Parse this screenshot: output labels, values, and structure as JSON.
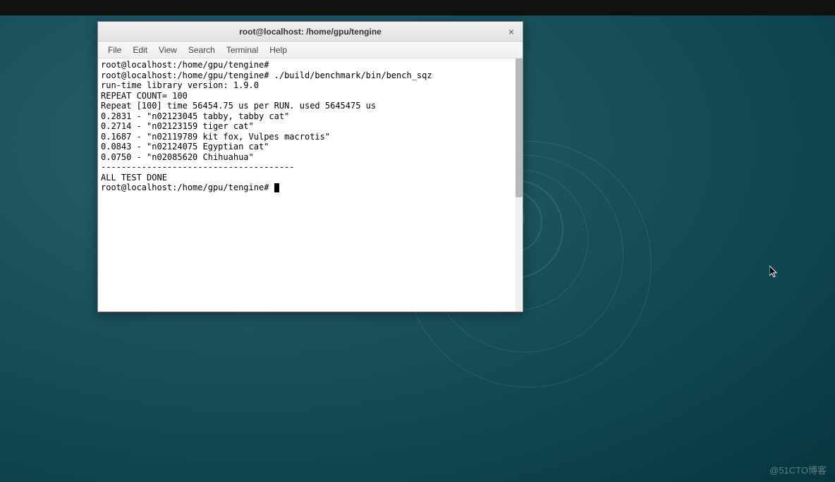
{
  "window": {
    "title": "root@localhost: /home/gpu/tengine",
    "close_label": "×"
  },
  "menubar": {
    "items": [
      "File",
      "Edit",
      "View",
      "Search",
      "Terminal",
      "Help"
    ]
  },
  "terminal": {
    "lines": [
      "root@localhost:/home/gpu/tengine#",
      "root@localhost:/home/gpu/tengine# ./build/benchmark/bin/bench_sqz",
      "run-time library version: 1.9.0",
      "REPEAT COUNT= 100",
      "Repeat [100] time 56454.75 us per RUN. used 5645475 us",
      "0.2831 - \"n02123045 tabby, tabby cat\"",
      "0.2714 - \"n02123159 tiger cat\"",
      "0.1687 - \"n02119789 kit fox, Vulpes macrotis\"",
      "0.0843 - \"n02124075 Egyptian cat\"",
      "0.0750 - \"n02085620 Chihuahua\"",
      "--------------------------------------",
      "ALL TEST DONE",
      "root@localhost:/home/gpu/tengine# "
    ]
  },
  "watermark": "@51CTO博客"
}
